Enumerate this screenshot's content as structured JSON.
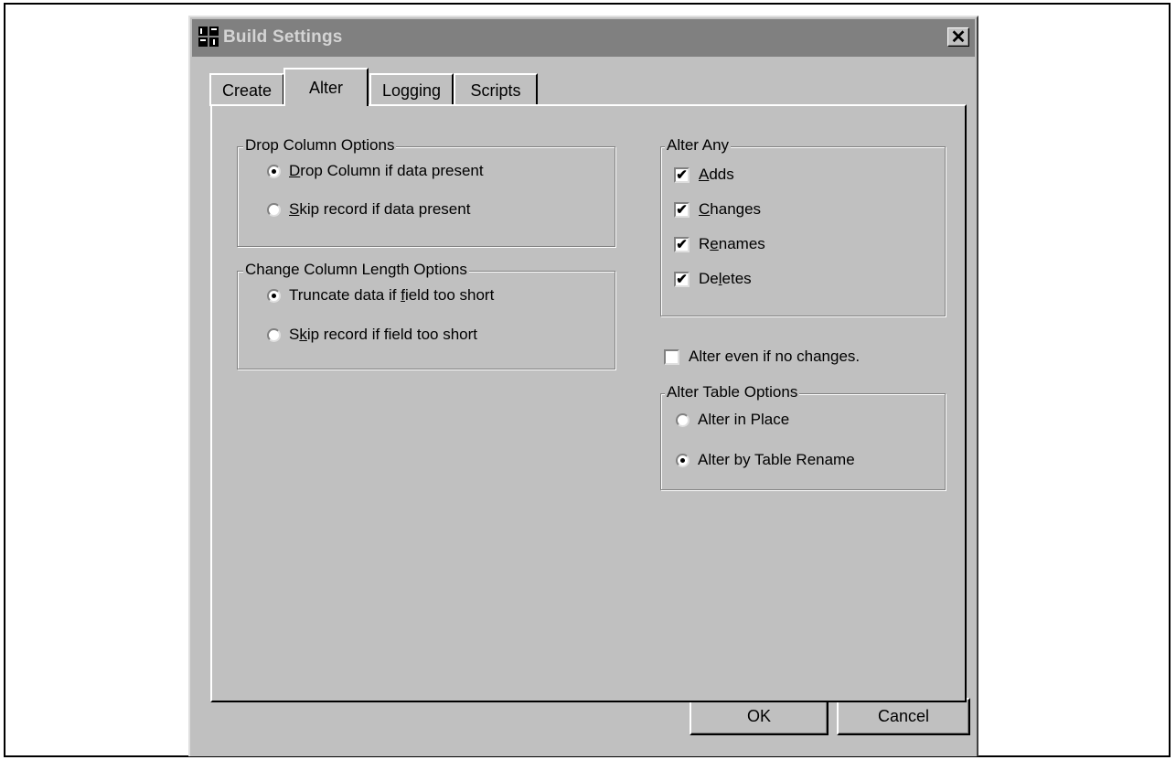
{
  "window": {
    "title": "Build Settings",
    "close_glyph": "✕",
    "icon": "app-icon"
  },
  "tabs": [
    {
      "label": "Create",
      "active": false
    },
    {
      "label": "Alter",
      "active": true
    },
    {
      "label": "Logging",
      "active": false
    },
    {
      "label": "Scripts",
      "active": false
    }
  ],
  "drop_column": {
    "title": "Drop Column Options",
    "options": [
      {
        "mnemonic": "D",
        "rest": "rop Column if data present",
        "selected": true
      },
      {
        "mnemonic": "S",
        "rest": "kip record if data present",
        "selected": false
      }
    ]
  },
  "change_length": {
    "title": "Change Column Length Options",
    "options": [
      {
        "pre": "Truncate data if ",
        "mnemonic": "f",
        "rest": "ield too short",
        "selected": true
      },
      {
        "pre": "S",
        "mnemonic": "k",
        "rest": "ip record if field too short",
        "selected": false
      }
    ]
  },
  "alter_any": {
    "title": "Alter Any",
    "items": [
      {
        "pre": "",
        "mnemonic": "A",
        "rest": "dds",
        "checked": true
      },
      {
        "pre": "",
        "mnemonic": "C",
        "rest": "hanges",
        "checked": true
      },
      {
        "pre": "R",
        "mnemonic": "e",
        "rest": "names",
        "checked": true
      },
      {
        "pre": "De",
        "mnemonic": "l",
        "rest": "etes",
        "checked": true
      }
    ]
  },
  "alter_even": {
    "label": "Alter even if no changes.",
    "checked": false
  },
  "alter_table": {
    "title": "Alter Table Options",
    "options": [
      {
        "label": "Alter in Place",
        "selected": false
      },
      {
        "label": "Alter by Table Rename",
        "selected": true
      }
    ]
  },
  "buttons": {
    "ok": "OK",
    "cancel": "Cancel"
  },
  "check_glyph": "✔"
}
